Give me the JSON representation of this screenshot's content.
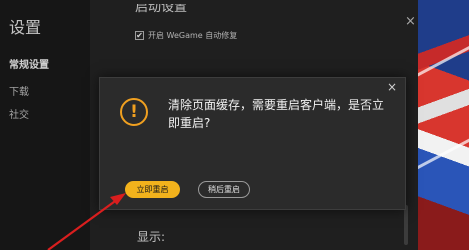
{
  "settings": {
    "title": "设置",
    "nav": [
      {
        "label": "常规设置",
        "active": true
      },
      {
        "label": "下载",
        "active": false
      },
      {
        "label": "社交",
        "active": false
      }
    ],
    "section_heading_partial": "启动设置",
    "checkbox": {
      "label": "开启 WeGame 自动修复",
      "checked": true
    },
    "display_heading": "显示:",
    "close_glyph": "×"
  },
  "dialog": {
    "message": "清除页面缓存，需要重启客户端，是否立即重启?",
    "close_glyph": "×",
    "icon": "warning-exclamation",
    "warning_glyph": "!",
    "buttons": {
      "primary": "立即重启",
      "secondary": "稍后重启"
    }
  },
  "colors": {
    "accent": "#f2b21c",
    "warning": "#f0a020",
    "annotation": "#d91e1e"
  }
}
